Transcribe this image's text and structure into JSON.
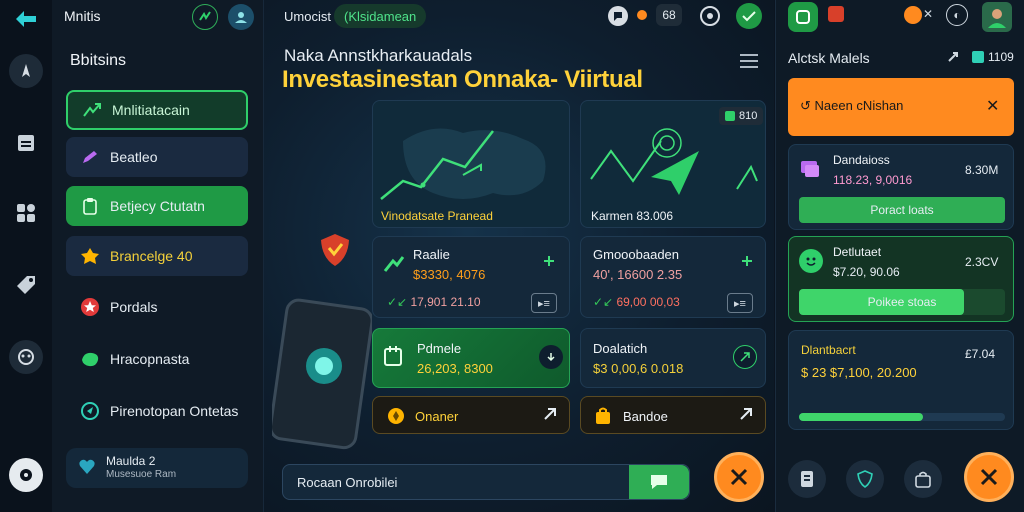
{
  "app_title": "Mnitis",
  "topbar": {
    "left_label": "Umocist",
    "badge": "(Klsidamean",
    "right_badge": "68"
  },
  "sidebar": {
    "title": "Bbitsins",
    "items": [
      {
        "label": "Mnlitiatacain",
        "icon": "chart-up-icon"
      },
      {
        "label": "Beatleo",
        "icon": "pen-icon"
      },
      {
        "label": "Betjecy Ctutatn",
        "icon": "clipboard-icon"
      },
      {
        "label": "Brancelge 40",
        "icon": "star-badge-icon"
      },
      {
        "label": "Pordals",
        "icon": "star-icon"
      },
      {
        "label": "Hracopnasta",
        "icon": "leaf-icon"
      },
      {
        "label": "Pirenotopan Ontetas",
        "icon": "location-icon"
      }
    ],
    "footer": {
      "name": "Maulda 2",
      "subtitle": "Musesuoe Ram"
    }
  },
  "main": {
    "subtitle": "Naka Annstkharkauadals",
    "title": "Investasinestan Onnaka- Viirtual",
    "hero_left_caption": "Vinodatsate Pranead",
    "hero_right_badge": "810",
    "hero_right_caption": "Karmen 83.006",
    "stats": [
      {
        "title": "Raalie",
        "value": "$3330, 4076",
        "sub": "17,901 21.10"
      },
      {
        "title": "Gmooobaaden",
        "value": "40', 16600 2.35",
        "sub": "69,00 00,03"
      },
      {
        "title": "Pdmele",
        "value": "26,203, 8300",
        "sub": ""
      },
      {
        "title": "Doalatich",
        "value": "$3 0,00,6 0.018",
        "sub": ""
      }
    ],
    "actions": [
      {
        "label": "Onaner"
      },
      {
        "label": "Bandoe"
      }
    ],
    "bottom_input": "Rocaan Onrobilei"
  },
  "right": {
    "title": "Alctsk Malels",
    "counter": "1109",
    "alert": "Naeen cNishan",
    "cards": [
      {
        "title": "Dandaioss",
        "amount": "8.30M",
        "value": "118.23, 9,0016",
        "button": "Poract loats"
      },
      {
        "title": "Detlutaet",
        "amount": "2.3CV",
        "value": "$7.20, 90.06",
        "button": "Poikee stoas",
        "progress": 0.8
      },
      {
        "title": "Dlantbacrt",
        "amount": "£7.04",
        "value": "$ 23 $7,100, 20.200",
        "progress": 0.6
      }
    ]
  },
  "colors": {
    "accent_green": "#2ea84f",
    "accent_orange": "#ff8a1f",
    "title_yellow": "#ffd23a"
  }
}
